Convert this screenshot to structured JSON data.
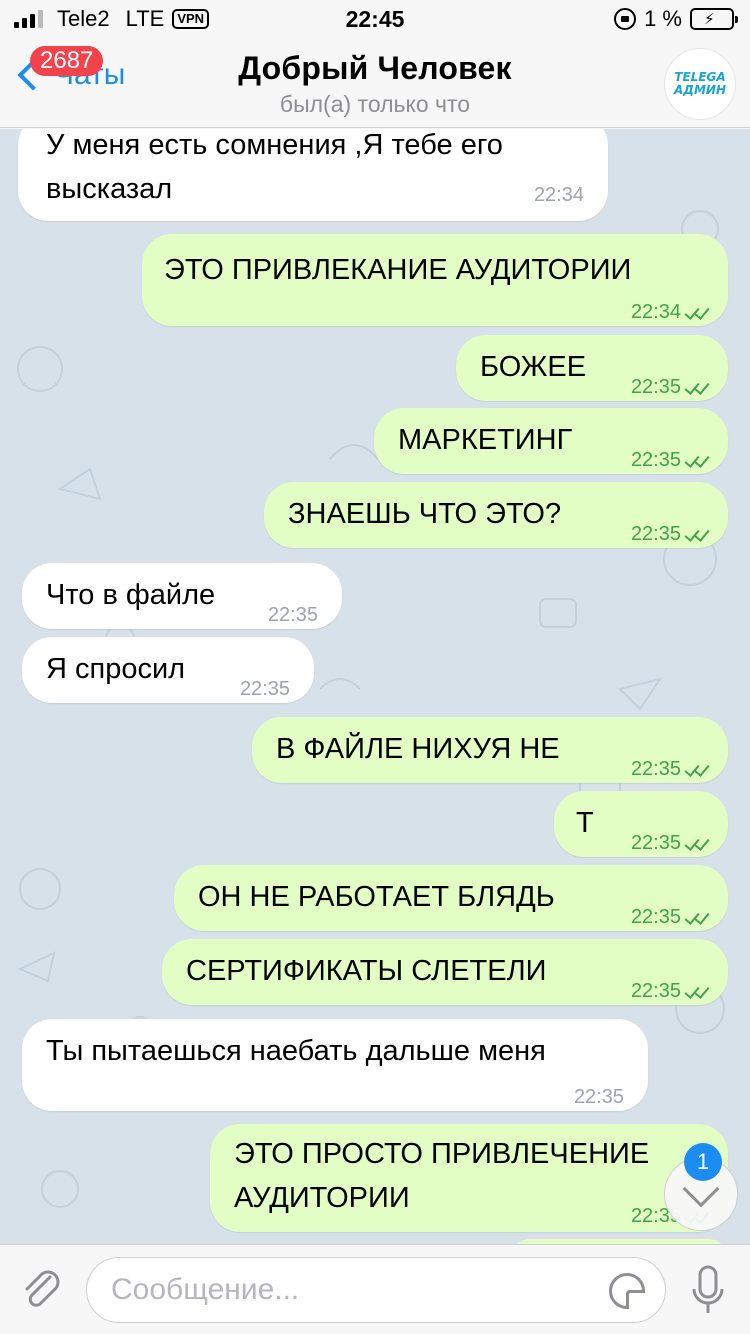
{
  "status_bar": {
    "carrier": "Tele2",
    "network": "LTE",
    "vpn": "VPN",
    "time": "22:45",
    "battery": "1 %"
  },
  "nav": {
    "back_label": "Чаты",
    "unread_count": "2687",
    "title": "Добрый Человек",
    "subtitle": "был(а) только что",
    "avatar_line1": "TELEGA",
    "avatar_line2": "АДМИН"
  },
  "messages": [
    {
      "dir": "in",
      "lines": [
        "У меня есть сомнения ,Я тебе его",
        "высказал"
      ],
      "time": "22:34"
    },
    {
      "dir": "out",
      "lines": [
        "ЭТО ПРИВЛЕКАНИЕ АУДИТОРИИ"
      ],
      "time": "22:34"
    },
    {
      "dir": "out",
      "lines": [
        "БОЖЕЕ"
      ],
      "time": "22:35"
    },
    {
      "dir": "out",
      "lines": [
        "МАРКЕТИНГ"
      ],
      "time": "22:35"
    },
    {
      "dir": "out",
      "lines": [
        "ЗНАЕШЬ ЧТО ЭТО?"
      ],
      "time": "22:35"
    },
    {
      "dir": "in",
      "lines": [
        "Что в файле"
      ],
      "time": "22:35"
    },
    {
      "dir": "in",
      "lines": [
        "Я спросил"
      ],
      "time": "22:35"
    },
    {
      "dir": "out",
      "lines": [
        "В ФАЙЛЕ НИХУЯ НЕ"
      ],
      "time": "22:35"
    },
    {
      "dir": "out",
      "lines": [
        "Т"
      ],
      "time": "22:35"
    },
    {
      "dir": "out",
      "lines": [
        "ОН НЕ РАБОТАЕТ БЛЯДЬ"
      ],
      "time": "22:35"
    },
    {
      "dir": "out",
      "lines": [
        "СЕРТИФИКАТЫ СЛЕТЕЛИ"
      ],
      "time": "22:35"
    },
    {
      "dir": "in",
      "lines": [
        "Ты пытаешься наебать дальше меня"
      ],
      "time": "22:35"
    },
    {
      "dir": "out",
      "lines": [
        "ЭТО ПРОСТО ПРИВЛЕЧЕНИЕ",
        "АУДИТОРИИ"
      ],
      "time": "22:35"
    }
  ],
  "scroll_down_badge": "1",
  "composer": {
    "placeholder": "Сообщение..."
  },
  "colors": {
    "accent": "#1b8df0",
    "outgoing_bubble": "#e2fec5",
    "incoming_bubble": "#ffffff",
    "chat_background": "#d6e1ea",
    "read_ticks": "#41a34a",
    "badge": "#f2434c"
  }
}
